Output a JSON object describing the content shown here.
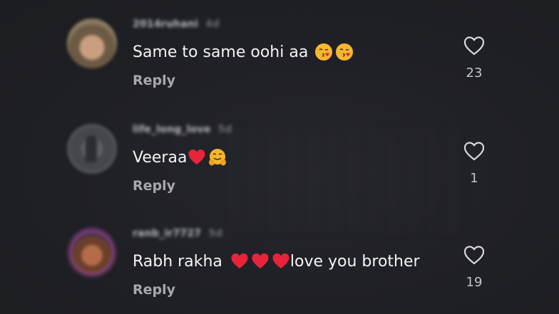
{
  "comments": [
    {
      "username": "2014ruhani",
      "time": "4d",
      "text": "Same to same oohi aa",
      "emojis": [
        "kiss-face-emoji",
        "kiss-face-emoji"
      ],
      "reply_label": "Reply",
      "likes": "23"
    },
    {
      "username": "life_long_love",
      "time": "5d",
      "text": "Veeraa",
      "emojis": [
        "red-heart-emoji",
        "hugging-face-emoji"
      ],
      "reply_label": "Reply",
      "likes": "1"
    },
    {
      "username": "ranb_ir7727",
      "time": "5d",
      "text_before": "Rabh rakha ",
      "text_after": "love you brother",
      "emojis": [
        "red-heart-emoji",
        "red-heart-emoji",
        "red-heart-emoji"
      ],
      "reply_label": "Reply",
      "likes": "19"
    }
  ],
  "colors": {
    "background": "#1e1f24",
    "heart_emoji": "#e8243c",
    "emoji_face": "#f7b72e"
  },
  "icons": {
    "like": "heart-outline-icon"
  }
}
